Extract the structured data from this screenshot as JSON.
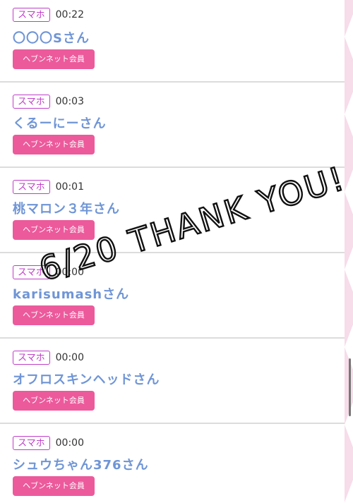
{
  "entries": [
    {
      "device": "スマホ",
      "time": "00:22",
      "name": "〇〇〇Sさん",
      "member": "ヘブンネット会員"
    },
    {
      "device": "スマホ",
      "time": "00:03",
      "name": "くるーにーさん",
      "member": "ヘブンネット会員"
    },
    {
      "device": "スマホ",
      "time": "00:01",
      "name": "桃マロン３年さん",
      "member": "ヘブンネット会員"
    },
    {
      "device": "スマホ",
      "time": "00:00",
      "name": "karisumashさん",
      "member": "ヘブンネット会員"
    },
    {
      "device": "スマホ",
      "time": "00:00",
      "name": "オフロスキンヘッドさん",
      "member": "ヘブンネット会員"
    },
    {
      "device": "スマホ",
      "time": "00:00",
      "name": "シュウちゃん376さん",
      "member": "ヘブンネット会員"
    }
  ],
  "overlay": {
    "text": "6/20 THANK YOU!"
  },
  "colors": {
    "device_border": "#c03cc9",
    "name": "#6f95d6",
    "member_bg": "#ec5a9c",
    "separator": "#dcdcdc",
    "edge": "#f7dce9"
  }
}
